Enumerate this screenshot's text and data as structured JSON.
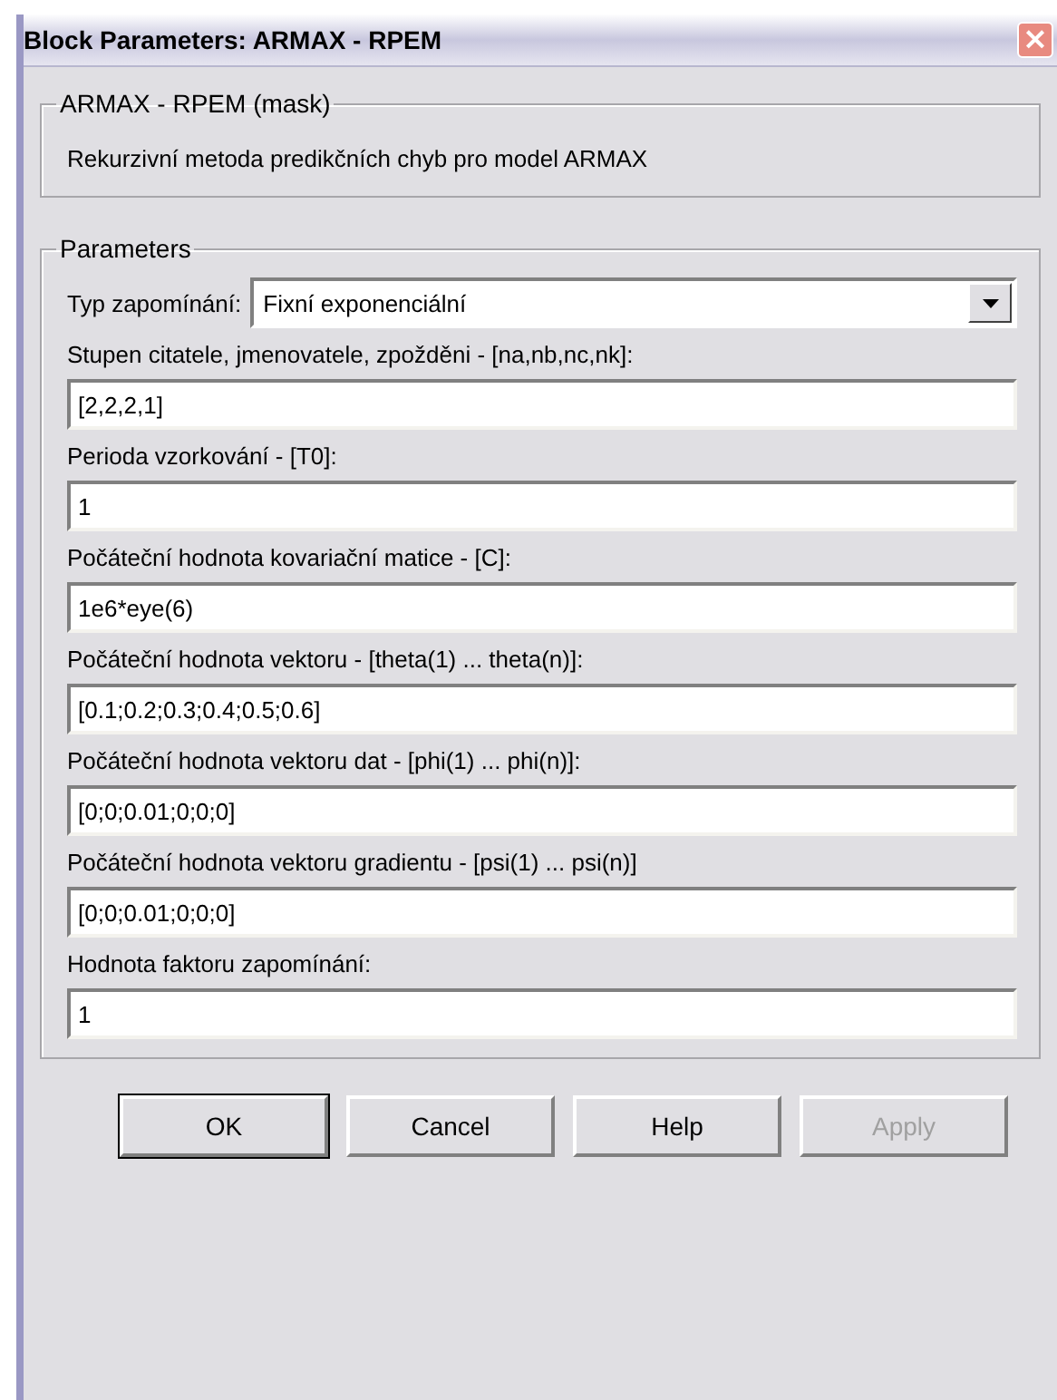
{
  "window": {
    "title": "Block Parameters: ARMAX - RPEM",
    "close": "×"
  },
  "mask": {
    "title": "ARMAX - RPEM (mask)",
    "description": "Rekurzivní metoda predikčních chyb pro model ARMAX"
  },
  "parameters": {
    "title": "Parameters",
    "fields": [
      {
        "kind": "dropdown",
        "label": "Typ zapomínání:",
        "value": "Fixní exponenciální"
      },
      {
        "kind": "text",
        "label": "Stupen citatele, jmenovatele, zpožděni - [na,nb,nc,nk]:",
        "value": "[2,2,2,1]"
      },
      {
        "kind": "text",
        "label": "Perioda vzorkování - [T0]:",
        "value": "1"
      },
      {
        "kind": "text",
        "label": "Počáteční hodnota kovariační matice - [C]:",
        "value": "1e6*eye(6)"
      },
      {
        "kind": "text",
        "label": "Počáteční hodnota vektoru - [theta(1) ... theta(n)]:",
        "value": "[0.1;0.2;0.3;0.4;0.5;0.6]"
      },
      {
        "kind": "text",
        "label": "Počáteční hodnota vektoru dat - [phi(1) ... phi(n)]:",
        "value": "[0;0;0.01;0;0;0]"
      },
      {
        "kind": "text",
        "label": "Počáteční hodnota vektoru gradientu - [psi(1) ... psi(n)]",
        "value": "[0;0;0.01;0;0;0]"
      },
      {
        "kind": "text",
        "label": "Hodnota faktoru zapomínání:",
        "value": "1"
      }
    ]
  },
  "buttons": [
    {
      "label": "OK",
      "default": true,
      "disabled": false
    },
    {
      "label": "Cancel",
      "default": false,
      "disabled": false
    },
    {
      "label": "Help",
      "default": false,
      "disabled": false
    },
    {
      "label": "Apply",
      "default": false,
      "disabled": true
    }
  ]
}
